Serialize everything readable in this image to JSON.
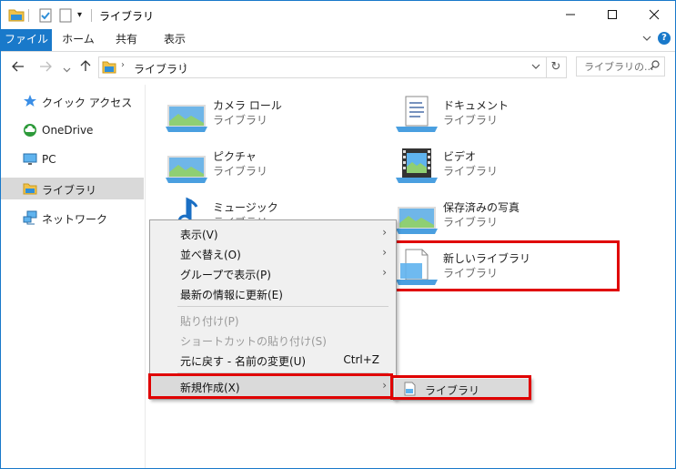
{
  "window": {
    "title": "ライブラリ"
  },
  "ribbon": {
    "tabs": [
      "ファイル",
      "ホーム",
      "共有",
      "表示"
    ]
  },
  "address": {
    "path": [
      "ライブラリ"
    ],
    "search_placeholder": "ライブラリの..."
  },
  "nav": {
    "items": [
      {
        "label": "クイック アクセス",
        "icon": "star-icon"
      },
      {
        "label": "OneDrive",
        "icon": "cloud-icon"
      },
      {
        "label": "PC",
        "icon": "monitor-icon"
      },
      {
        "label": "ライブラリ",
        "icon": "library-icon",
        "selected": true
      },
      {
        "label": "ネットワーク",
        "icon": "network-icon"
      }
    ]
  },
  "libraries": [
    {
      "name": "カメラ ロール",
      "type": "ライブラリ",
      "icon": "picture-library-icon"
    },
    {
      "name": "ドキュメント",
      "type": "ライブラリ",
      "icon": "document-library-icon"
    },
    {
      "name": "ピクチャ",
      "type": "ライブラリ",
      "icon": "picture-library-icon"
    },
    {
      "name": "ビデオ",
      "type": "ライブラリ",
      "icon": "video-library-icon"
    },
    {
      "name": "ミュージック",
      "type": "ライブラリ",
      "icon": "music-library-icon"
    },
    {
      "name": "保存済みの写真",
      "type": "ライブラリ",
      "icon": "picture-library-icon"
    },
    {
      "name": "新しいライブラリ",
      "type": "ライブラリ",
      "icon": "new-library-icon"
    }
  ],
  "context_menu": {
    "items": [
      {
        "label": "表示(V)",
        "submenu": true
      },
      {
        "label": "並べ替え(O)",
        "submenu": true
      },
      {
        "label": "グループで表示(P)",
        "submenu": true
      },
      {
        "label": "最新の情報に更新(E)"
      },
      {
        "label": "貼り付け(P)",
        "disabled": true
      },
      {
        "label": "ショートカットの貼り付け(S)",
        "disabled": true
      },
      {
        "label": "元に戻す - 名前の変更(U)",
        "shortcut": "Ctrl+Z"
      },
      {
        "label": "新規作成(X)",
        "submenu": true,
        "highlighted": true
      }
    ],
    "submenu": {
      "label": "ライブラリ"
    }
  },
  "colors": {
    "accent": "#1979ca",
    "highlight_box": "#e00000"
  }
}
